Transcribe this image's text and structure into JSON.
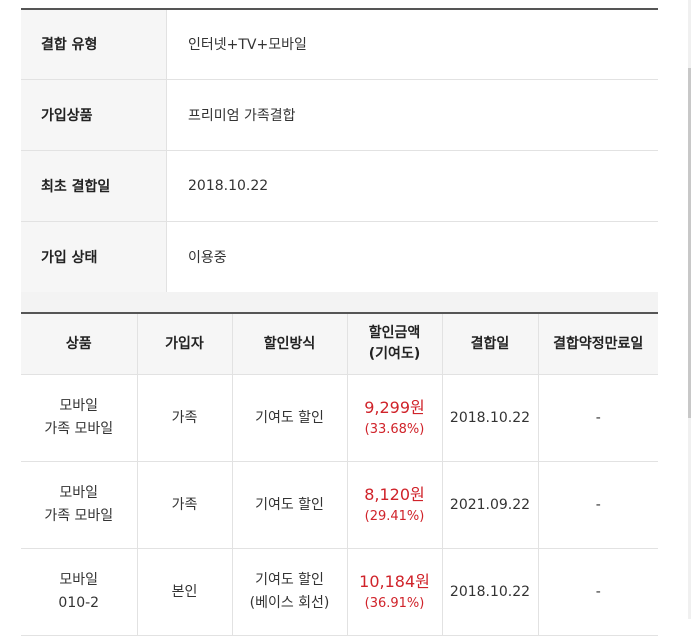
{
  "info": {
    "rows": [
      {
        "label": "결합 유형",
        "value": "인터넷+TV+모바일"
      },
      {
        "label": "가입상품",
        "value": "프리미엄 가족결합"
      },
      {
        "label": "최초 결합일",
        "value": "2018.10.22"
      },
      {
        "label": "가입 상태",
        "value": "이용중"
      }
    ]
  },
  "discount": {
    "headers": {
      "product": "상품",
      "subscriber": "가입자",
      "method": "할인방식",
      "amount_line1": "할인금액",
      "amount_line2": "(기여도)",
      "join_date": "결합일",
      "expiry": "결합약정만료일"
    },
    "rows": [
      {
        "product_line1": "모바일",
        "product_line2": "가족 모바일",
        "subscriber": "가족",
        "method_line1": "기여도 할인",
        "method_line2": "",
        "amount": "9,299원",
        "percent": "(33.68%)",
        "join_date": "2018.10.22",
        "expiry": "-"
      },
      {
        "product_line1": "모바일",
        "product_line2": "가족 모바일",
        "subscriber": "가족",
        "method_line1": "기여도 할인",
        "method_line2": "",
        "amount": "8,120원",
        "percent": "(29.41%)",
        "join_date": "2021.09.22",
        "expiry": "-"
      },
      {
        "product_line1": "모바일",
        "product_line2": "010-2",
        "subscriber": "본인",
        "method_line1": "기여도 할인",
        "method_line2": "(베이스 회선)",
        "amount": "10,184원",
        "percent": "(36.91%)",
        "join_date": "2018.10.22",
        "expiry": "-"
      }
    ]
  },
  "colors": {
    "accent_red": "#d0232a",
    "header_bg": "#f6f6f6"
  }
}
